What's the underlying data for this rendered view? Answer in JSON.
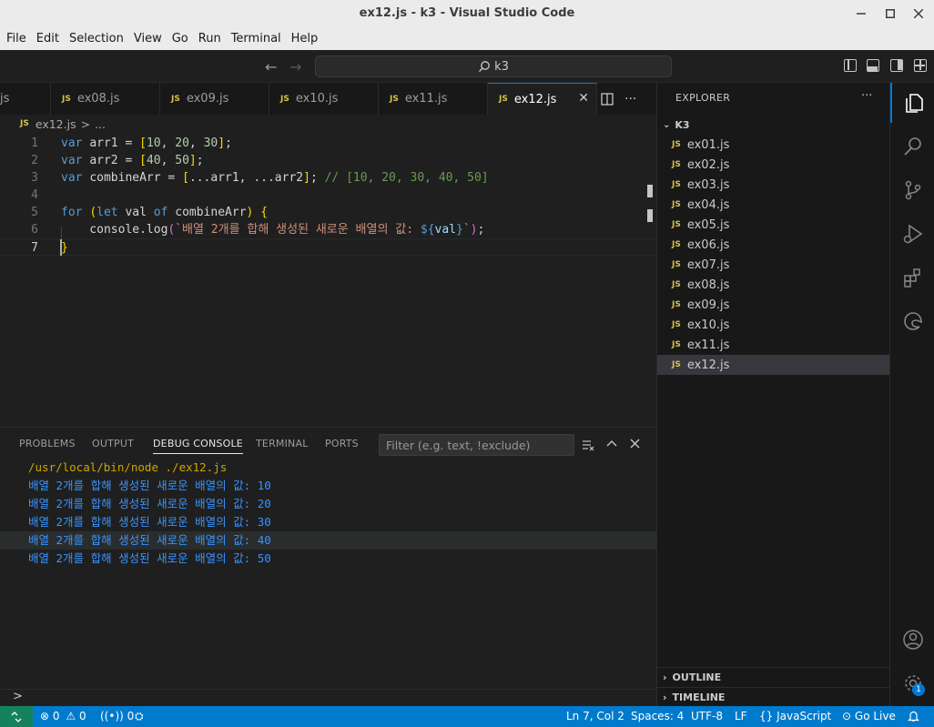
{
  "window": {
    "title": "ex12.js - k3 - Visual Studio Code"
  },
  "menu": [
    "File",
    "Edit",
    "Selection",
    "View",
    "Go",
    "Run",
    "Terminal",
    "Help"
  ],
  "command_center": {
    "text": "k3"
  },
  "tabs": [
    {
      "label": "js",
      "active": false
    },
    {
      "label": "ex08.js",
      "active": false
    },
    {
      "label": "ex09.js",
      "active": false
    },
    {
      "label": "ex10.js",
      "active": false
    },
    {
      "label": "ex11.js",
      "active": false
    },
    {
      "label": "ex12.js",
      "active": true
    }
  ],
  "js_badge": "JS",
  "breadcrumb": {
    "file": "ex12.js",
    "sep": ">",
    "rest": "..."
  },
  "editor": {
    "current_line": 7,
    "lines": [
      {
        "n": "1",
        "tokens": [
          [
            "kw",
            "var "
          ],
          [
            "plain",
            "arr1 = "
          ],
          [
            "br1",
            "["
          ],
          [
            "num",
            "10"
          ],
          [
            "plain",
            ", "
          ],
          [
            "num",
            "20"
          ],
          [
            "plain",
            ", "
          ],
          [
            "num",
            "30"
          ],
          [
            "br1",
            "]"
          ],
          [
            "plain",
            ";"
          ]
        ]
      },
      {
        "n": "2",
        "tokens": [
          [
            "kw",
            "var "
          ],
          [
            "plain",
            "arr2 = "
          ],
          [
            "br1",
            "["
          ],
          [
            "num",
            "40"
          ],
          [
            "plain",
            ", "
          ],
          [
            "num",
            "50"
          ],
          [
            "br1",
            "]"
          ],
          [
            "plain",
            ";"
          ]
        ]
      },
      {
        "n": "3",
        "tokens": [
          [
            "kw",
            "var "
          ],
          [
            "plain",
            "combineArr = "
          ],
          [
            "br1",
            "["
          ],
          [
            "plain",
            "...arr1, ...arr2"
          ],
          [
            "br1",
            "]"
          ],
          [
            "plain",
            "; "
          ],
          [
            "cmt",
            "// [10, 20, 30, 40, 50]"
          ]
        ]
      },
      {
        "n": "4",
        "tokens": []
      },
      {
        "n": "5",
        "tokens": [
          [
            "kw",
            "for "
          ],
          [
            "br1",
            "("
          ],
          [
            "kw",
            "let "
          ],
          [
            "plain",
            "val "
          ],
          [
            "kw",
            "of "
          ],
          [
            "plain",
            "combineArr"
          ],
          [
            "br1",
            ")"
          ],
          [
            "plain",
            " "
          ],
          [
            "br1",
            "{"
          ]
        ]
      },
      {
        "n": "6",
        "tokens": [
          [
            "plain",
            "    console.log"
          ],
          [
            "br2",
            "("
          ],
          [
            "str",
            "`배열 2개를 합해 생성된 새로운 배열의 값: "
          ],
          [
            "kw",
            "${"
          ],
          [
            "var",
            "val"
          ],
          [
            "kw",
            "}"
          ],
          [
            "str",
            "`"
          ],
          [
            "br2",
            ")"
          ],
          [
            "plain",
            ";"
          ]
        ]
      },
      {
        "n": "7",
        "tokens": [
          [
            "br1",
            "}"
          ]
        ]
      }
    ]
  },
  "panel": {
    "tabs": [
      "PROBLEMS",
      "OUTPUT",
      "DEBUG CONSOLE",
      "TERMINAL",
      "PORTS"
    ],
    "active_tab": "DEBUG CONSOLE",
    "filter_placeholder": "Filter (e.g. text, !exclude)",
    "command": "/usr/local/bin/node ./ex12.js",
    "output": [
      "배열 2개를 합해 생성된 새로운 배열의 값: 10",
      "배열 2개를 합해 생성된 새로운 배열의 값: 20",
      "배열 2개를 합해 생성된 새로운 배열의 값: 30",
      "배열 2개를 합해 생성된 새로운 배열의 값: 40",
      "배열 2개를 합해 생성된 새로운 배열의 값: 50"
    ],
    "prompt": ">"
  },
  "explorer": {
    "title": "EXPLORER",
    "more": "···",
    "folder": "K3",
    "files": [
      "ex01.js",
      "ex02.js",
      "ex03.js",
      "ex04.js",
      "ex05.js",
      "ex06.js",
      "ex07.js",
      "ex08.js",
      "ex09.js",
      "ex10.js",
      "ex11.js",
      "ex12.js"
    ],
    "selected": "ex12.js",
    "sections": [
      "OUTLINE",
      "TIMELINE"
    ]
  },
  "activity": {
    "badge": "1"
  },
  "status": {
    "errors": "0",
    "warnings": "0",
    "ports": "0",
    "position": "Ln 7, Col 2",
    "spaces": "Spaces: 4",
    "encoding": "UTF-8",
    "eol": "LF",
    "language": "JavaScript",
    "golive": "Go Live"
  },
  "colors": {
    "accent": "#0078d4",
    "statusbar": "#007acc",
    "remote": "#16825d",
    "output": "#3794ff"
  }
}
